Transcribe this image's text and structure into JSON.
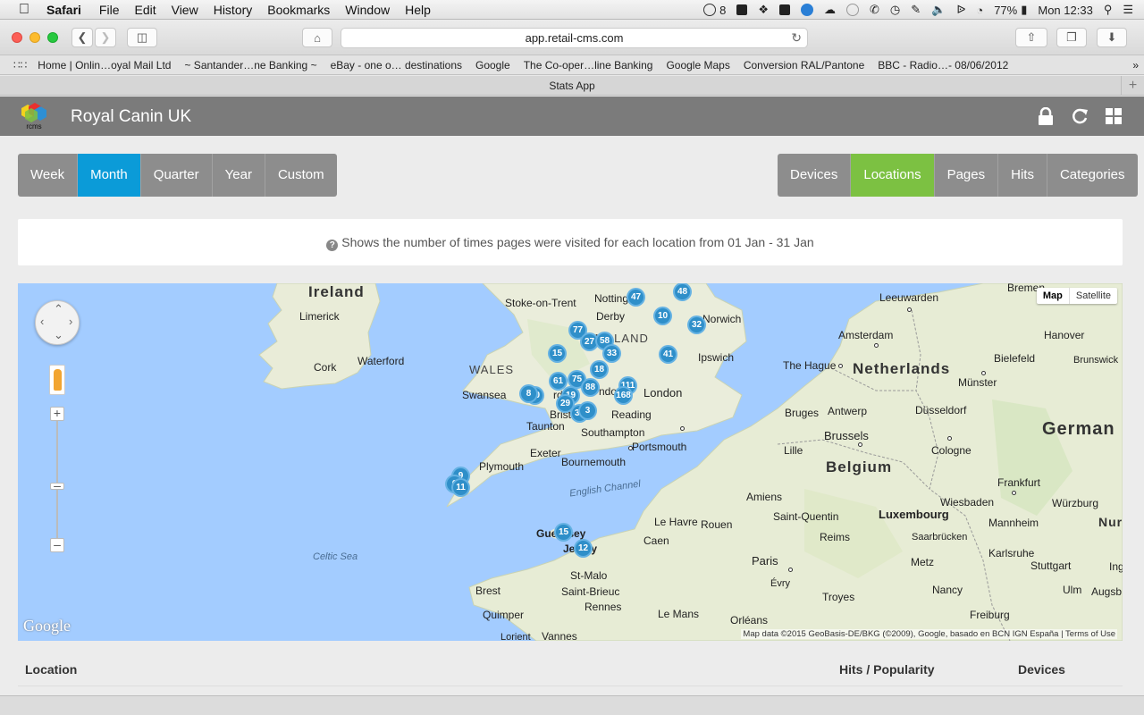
{
  "menubar": {
    "app_name": "Safari",
    "items": [
      "File",
      "Edit",
      "View",
      "History",
      "Bookmarks",
      "Window",
      "Help"
    ],
    "tray_badge": "8",
    "battery": "77%",
    "clock": "Mon 12:33"
  },
  "browser": {
    "url": "app.retail-cms.com",
    "tab_title": "Stats App",
    "bookmarks": [
      "Home | Onlin…oyal Mail Ltd",
      "~ Santander…ne Banking ~",
      "eBay - one o… destinations",
      "Google",
      "The Co-oper…line Banking",
      "Google Maps",
      "Conversion RAL/Pantone",
      "BBC - Radio…- 08/06/2012"
    ]
  },
  "app": {
    "title": "Royal Canin UK",
    "logo_text": "rcms",
    "period_buttons": [
      "Week",
      "Month",
      "Quarter",
      "Year",
      "Custom"
    ],
    "active_period": "Month",
    "view_buttons": [
      "Devices",
      "Locations",
      "Pages",
      "Hits",
      "Categories"
    ],
    "active_view": "Locations",
    "info_text": "Shows the number of times pages were visited for each location from 01 Jan - 31 Jan",
    "accent_blue": "#0b9bd8",
    "accent_green": "#7cc142"
  },
  "map": {
    "type_map": "Map",
    "type_satellite": "Satellite",
    "google_logo": "Google",
    "attribution": "Map data ©2015 GeoBasis-DE/BKG (©2009), Google, basado en BCN IGN España",
    "terms": "Terms of Use",
    "labels": {
      "ireland": "Ireland",
      "limerick": "Limerick",
      "cork": "Cork",
      "waterford": "Waterford",
      "wales": "WALES",
      "swansea": "Swansea",
      "stoke": "Stoke-on-Trent",
      "nottingham": "Notting",
      "derby": "Derby",
      "england": "ENGLAND",
      "norwich": "Norwich",
      "ipswich": "Ipswich",
      "london": "London",
      "reading": "Reading",
      "bristol": "Brist",
      "cardiff": "rdiff",
      "swindon": "ndon",
      "taunton": "Taunton",
      "southampton": "Southampton",
      "portsmouth": "Portsmouth",
      "exeter": "Exeter",
      "plymouth": "Plymouth",
      "bournemouth": "Bournemouth",
      "channel": "English Channel",
      "celtic": "Celtic Sea",
      "guernsey": "Guernsey",
      "jersey": "Jersey",
      "stmalo": "St-Malo",
      "brest": "Brest",
      "stbrieuc": "Saint-Brieuc",
      "rennes": "Rennes",
      "quimper": "Quimper",
      "lorient": "Lorient",
      "vannes": "Vannes",
      "lemans": "Le Mans",
      "caen": "Caen",
      "lehavre": "Le Havre",
      "rouen": "Rouen",
      "paris": "Paris",
      "evry": "Évry",
      "orleans": "Orléans",
      "troyes": "Troyes",
      "reims": "Reims",
      "amiens": "Amiens",
      "stquentin": "Saint-Quentin",
      "lille": "Lille",
      "bruges": "Bruges",
      "brussels": "Brussels",
      "antwerp": "Antwerp",
      "belgium": "Belgium",
      "thehague": "The Hague",
      "amsterdam": "Amsterdam",
      "netherlands": "Netherlands",
      "leeuwarden": "Leeuwarden",
      "bremen": "Bremen",
      "hanover": "Hanover",
      "bielefeld": "Bielefeld",
      "munster": "Münster",
      "brunswick": "Brunswick",
      "dusseldorf": "Düsseldorf",
      "cologne": "Cologne",
      "germany": "German",
      "frankfurt": "Frankfurt",
      "wiesbaden": "Wiesbaden",
      "wurzburg": "Würzburg",
      "mannheim": "Mannheim",
      "nuremberg": "Nure",
      "luxembourg": "Luxembourg",
      "saarbrucken": "Saarbrücken",
      "karlsruhe": "Karlsruhe",
      "stuttgart": "Stuttgart",
      "metz": "Metz",
      "nancy": "Nancy",
      "ulm": "Ulm",
      "augsburg": "Augsb",
      "ing": "Ing",
      "freiburg": "Freiburg"
    },
    "clusters": [
      "47",
      "48",
      "10",
      "32",
      "77",
      "27",
      "58",
      "33",
      "15",
      "41",
      "18",
      "75",
      "61",
      "88",
      "111",
      "168",
      "90",
      "8",
      "19",
      "29",
      "37",
      "3",
      "9",
      "6",
      "11",
      "15",
      "12"
    ]
  },
  "table": {
    "col_location": "Location",
    "col_hits": "Hits / Popularity",
    "col_devices": "Devices"
  }
}
